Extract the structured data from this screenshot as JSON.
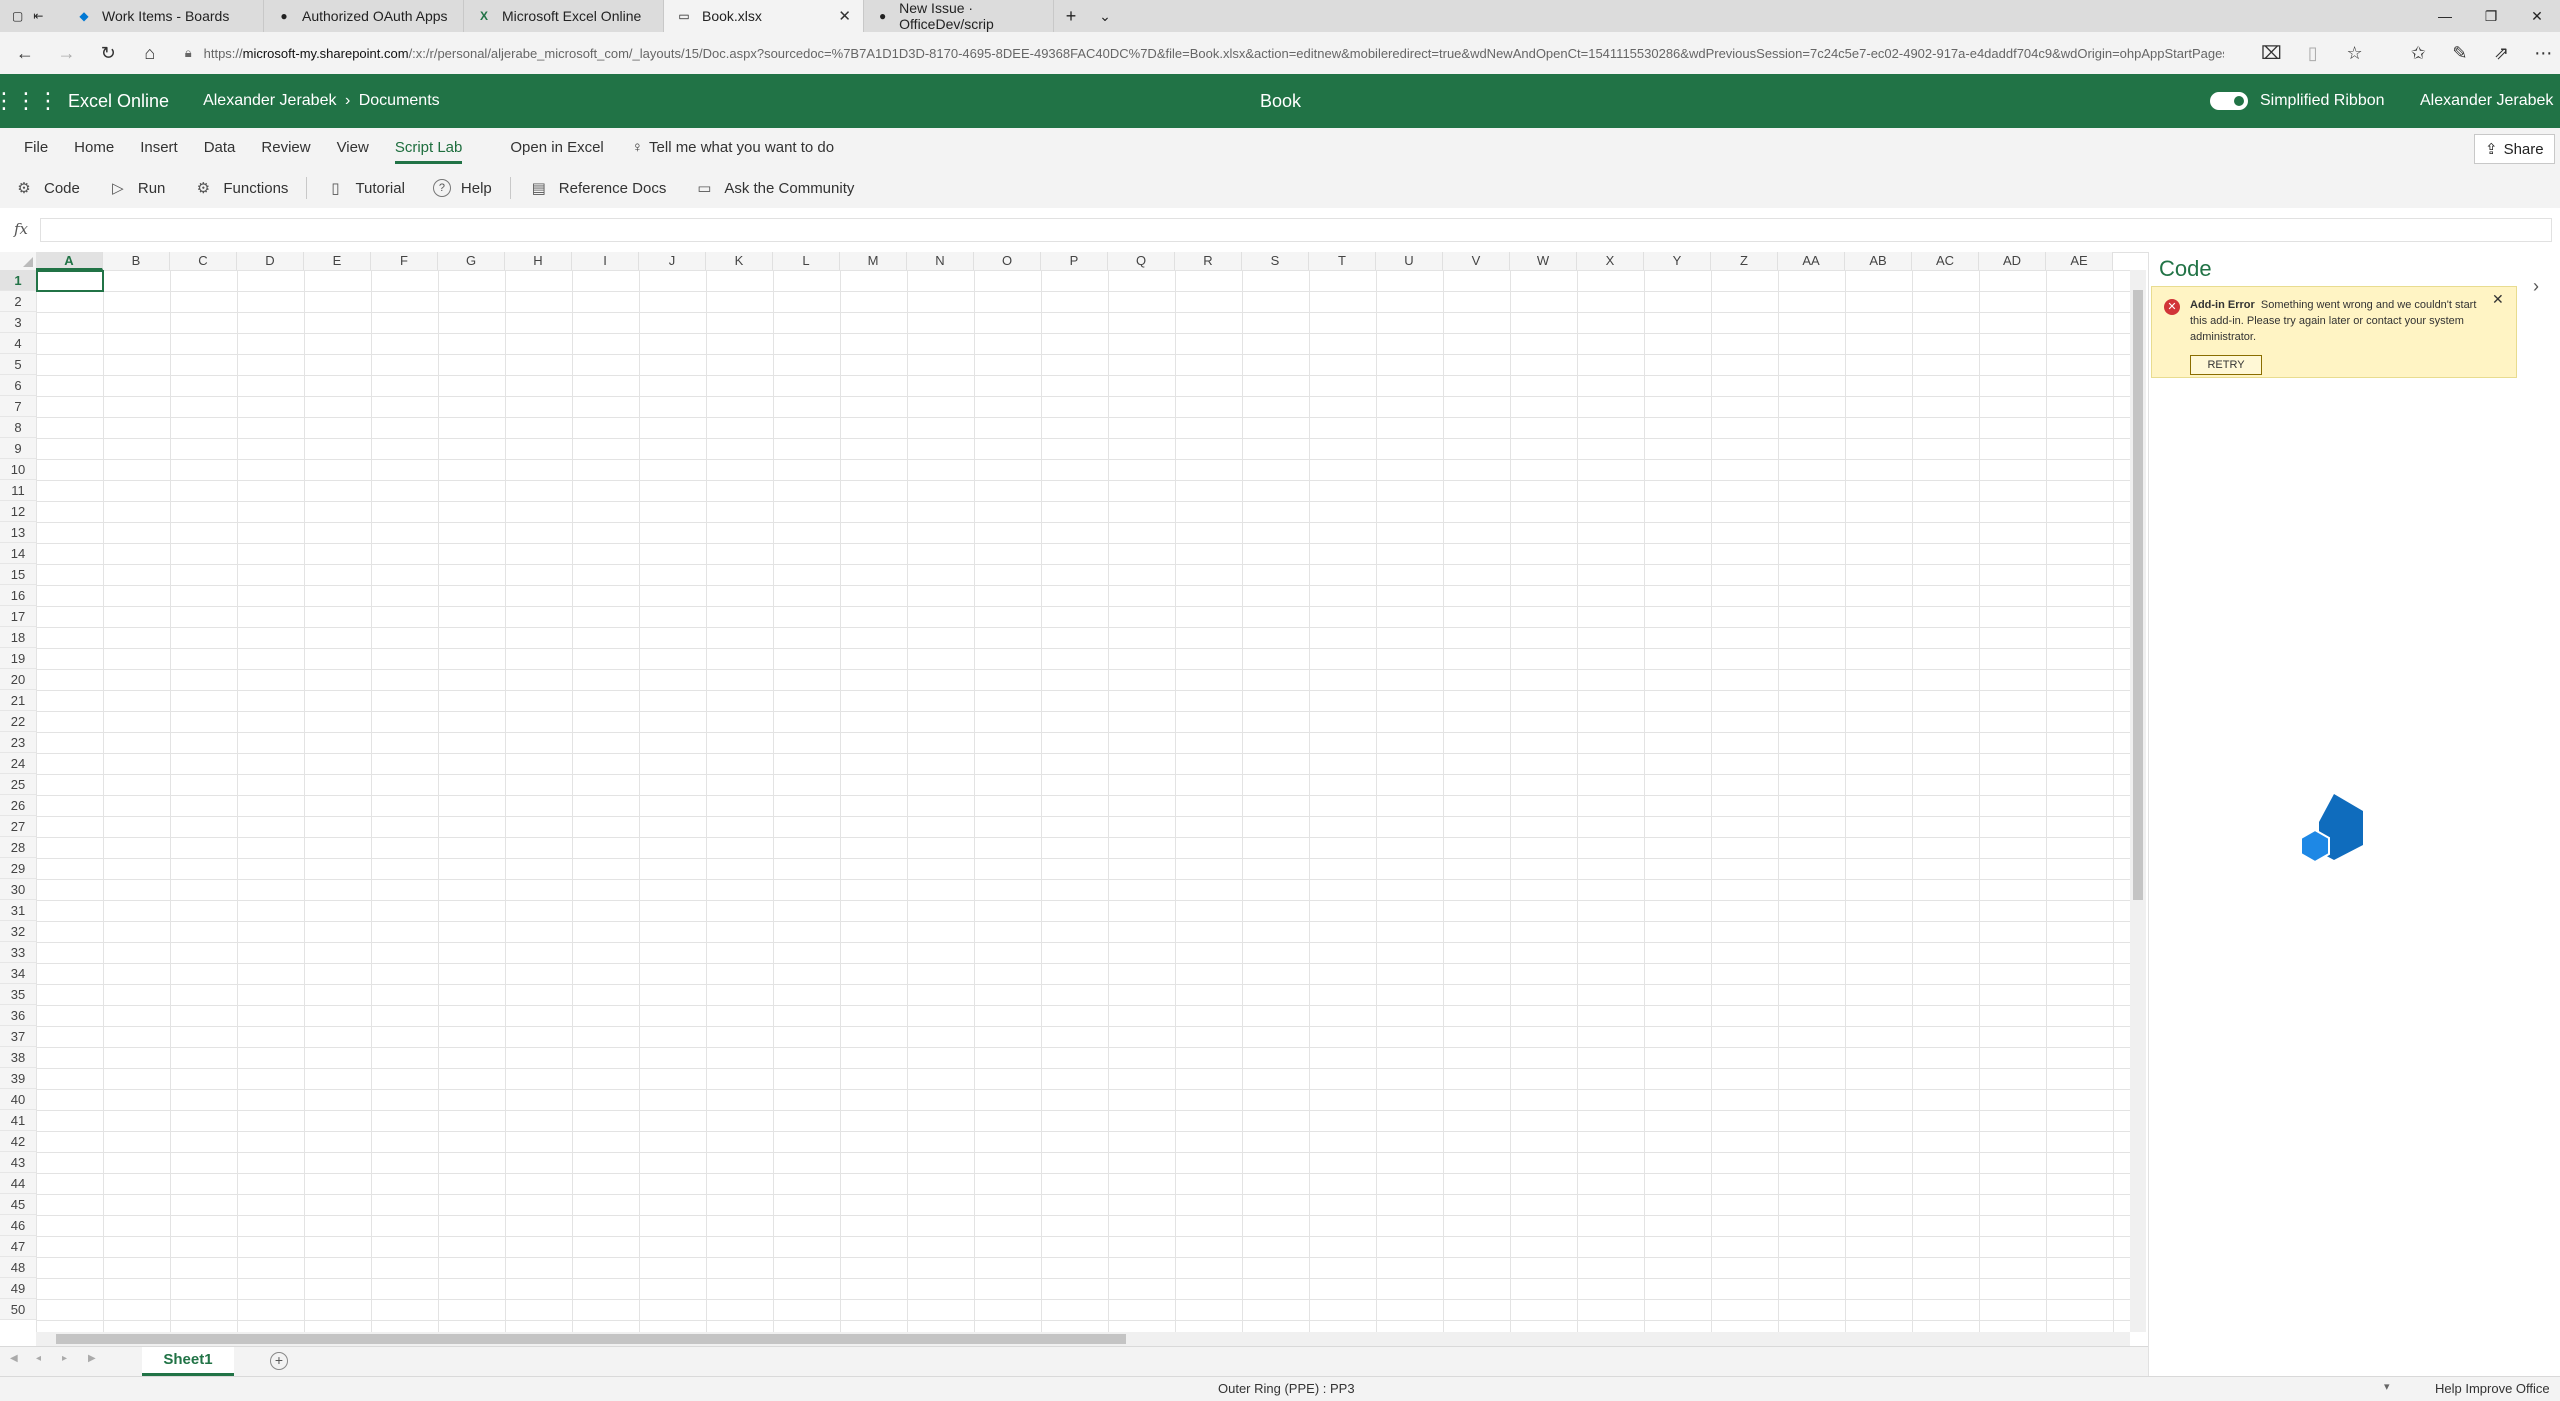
{
  "browser": {
    "tabs": [
      {
        "label": "Work Items - Boards",
        "icon": "azure-boards-icon"
      },
      {
        "label": "Authorized OAuth Apps",
        "icon": "github-icon"
      },
      {
        "label": "Microsoft Excel Online",
        "icon": "excel-icon"
      },
      {
        "label": "Book.xlsx",
        "icon": "page-icon",
        "active": true
      },
      {
        "label": "New Issue · OfficeDev/scrip",
        "icon": "github-icon"
      }
    ],
    "url_prefix": "https://",
    "url_host": "microsoft-my.sharepoint.com",
    "url_path": "/:x:/r/personal/aljerabe_microsoft_com/_layouts/15/Doc.aspx?sourcedoc=%7B7A1D1D3D-8170-4695-8DEE-49368FAC40DC%7D&file=Book.xlsx&action=editnew&mobileredirect=true&wdNewAndOpenCt=1541115530286&wdPreviousSession=7c24c5e7-ec02-4902-917a-e4daddf704c9&wdOrigin=ohpAppStartPages"
  },
  "app": {
    "name": "Excel Online",
    "breadcrumb_user": "Alexander Jerabek",
    "breadcrumb_sep": "›",
    "breadcrumb_folder": "Documents",
    "doc_title": "Book",
    "simplified_ribbon": "Simplified Ribbon",
    "user": "Alexander Jerabek"
  },
  "ribbon": {
    "tabs": [
      "File",
      "Home",
      "Insert",
      "Data",
      "Review",
      "View",
      "Script Lab"
    ],
    "active_tab": "Script Lab",
    "open_in_excel": "Open in Excel",
    "tell_me": "Tell me what you want to do",
    "share": "Share",
    "tools": {
      "code": "Code",
      "run": "Run",
      "functions": "Functions",
      "tutorial": "Tutorial",
      "help": "Help",
      "reference_docs": "Reference Docs",
      "ask_community": "Ask the Community"
    }
  },
  "formula": {
    "fx": "fx",
    "value": ""
  },
  "grid": {
    "columns": [
      "A",
      "B",
      "C",
      "D",
      "E",
      "F",
      "G",
      "H",
      "I",
      "J",
      "K",
      "L",
      "M",
      "N",
      "O",
      "P",
      "Q",
      "R",
      "S",
      "T",
      "U",
      "V",
      "W",
      "X",
      "Y",
      "Z",
      "AA",
      "AB",
      "AC",
      "AD",
      "AE"
    ],
    "selected_column": "A",
    "row_count": 50,
    "selected_row": 1
  },
  "sheets": {
    "active": "Sheet1"
  },
  "status": {
    "center": "Outer Ring (PPE) : PP3",
    "right": "Help Improve Office"
  },
  "taskpane": {
    "title": "Code",
    "error_title": "Add-in Error",
    "error_message": "Something went wrong and we couldn't start this add-in. Please try again later or contact your system administrator.",
    "retry": "RETRY"
  },
  "colors": {
    "excel_green": "#217346",
    "error_bg": "#fff4c4",
    "logo_blue": "#0f6cbd"
  }
}
